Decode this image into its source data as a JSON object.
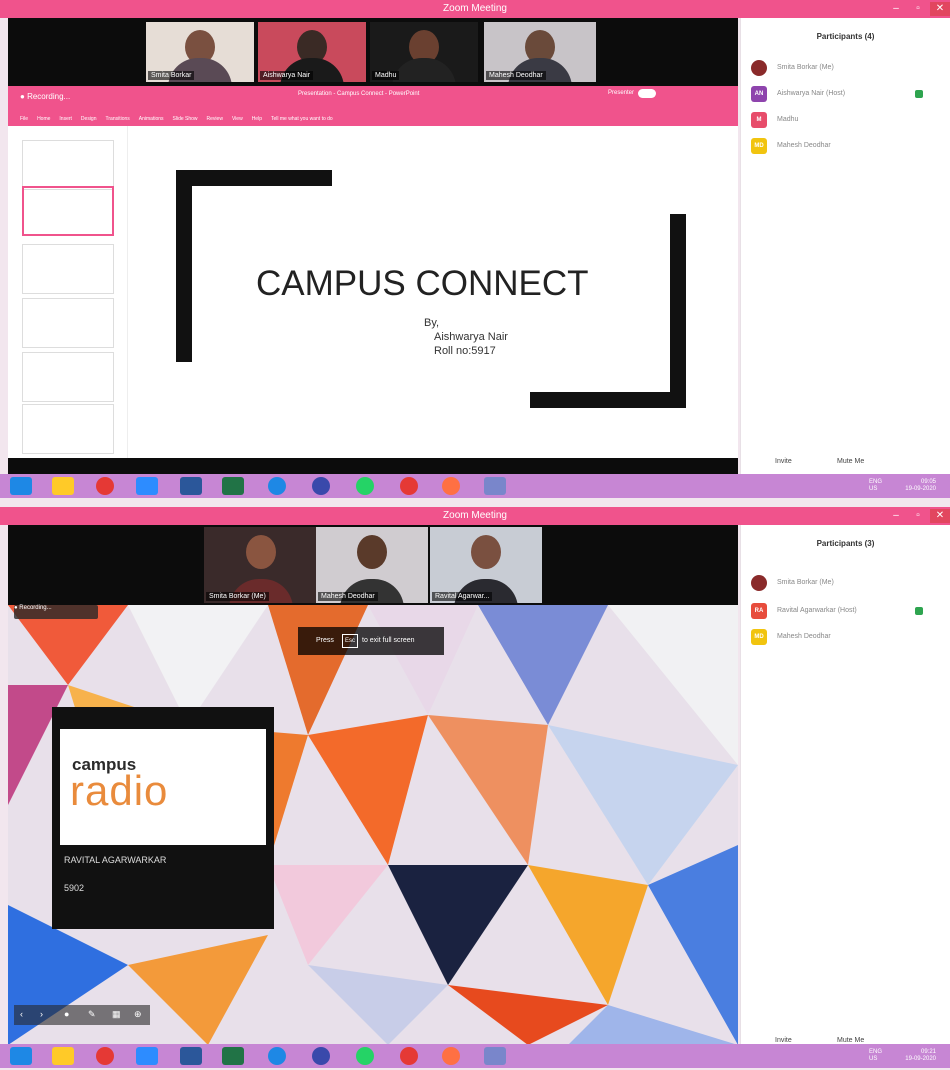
{
  "screen1": {
    "window_title": "Zoom Meeting",
    "participants": [
      {
        "name": "Smita Borkar"
      },
      {
        "name": "Aishwarya Nair"
      },
      {
        "name": "Madhu"
      },
      {
        "name": "Mahesh Deodhar"
      }
    ],
    "recording_label": "Recording...",
    "ppt": {
      "doc_title": "Presentation - Campus Connect - PowerPoint",
      "presenter_label": "Presenter",
      "tabs": [
        "File",
        "Home",
        "Insert",
        "Design",
        "Transitions",
        "Animations",
        "Slide Show",
        "Review",
        "View",
        "Help",
        "Tell me what you want to do"
      ]
    },
    "slide": {
      "title": "CAMPUS CONNECT",
      "by": "By,",
      "author": "Aishwarya Nair",
      "roll": "Roll no:5917"
    },
    "panel": {
      "title": "Participants (4)",
      "list": [
        {
          "name": "Smita Borkar (Me)",
          "initials": "",
          "color": "#c0392b"
        },
        {
          "name": "Aishwarya Nair (Host)",
          "initials": "AN",
          "color": "#8e44ad"
        },
        {
          "name": "Madhu",
          "initials": "M",
          "color": "#e74c6a"
        },
        {
          "name": "Mahesh Deodhar",
          "initials": "MD",
          "color": "#f1c40f"
        }
      ],
      "invite": "Invite",
      "mute": "Mute Me"
    },
    "tray": {
      "lang": "ENG",
      "region": "US",
      "time": "09:05",
      "date": "19-09-2020"
    }
  },
  "screen2": {
    "window_title": "Zoom Meeting",
    "participants": [
      {
        "name": "Smita Borkar (Me)"
      },
      {
        "name": "Mahesh Deodhar"
      },
      {
        "name": "Ravital Agarwar..."
      }
    ],
    "recording_label": "Recording...",
    "esc_overlay": {
      "press": "Press",
      "key": "Esc",
      "rest": "to exit full screen"
    },
    "card": {
      "logo_word1": "campus",
      "logo_word2": "radio",
      "name": "RAVITAL AGARWARKAR",
      "roll": "5902"
    },
    "panel": {
      "title": "Participants (3)",
      "list": [
        {
          "name": "Smita Borkar (Me)",
          "initials": "",
          "color": "#c0392b"
        },
        {
          "name": "Ravital Agarwarkar (Host)",
          "initials": "RA",
          "color": "#e74c3c"
        },
        {
          "name": "Mahesh Deodhar",
          "initials": "MD",
          "color": "#f1c40f"
        }
      ],
      "invite": "Invite",
      "mute": "Mute Me"
    },
    "tray": {
      "lang": "ENG",
      "region": "US",
      "time": "09:21",
      "date": "19-09-2020"
    }
  },
  "taskbar_icons": [
    {
      "icon": "windows-start-icon",
      "color": "#1e88e5"
    },
    {
      "icon": "file-explorer-icon",
      "color": "#ffca28"
    },
    {
      "icon": "chrome-icon",
      "color": "#e53935"
    },
    {
      "icon": "zoom-icon",
      "color": "#2d8cff"
    },
    {
      "icon": "word-icon",
      "color": "#2b579a"
    },
    {
      "icon": "excel-icon",
      "color": "#217346"
    },
    {
      "icon": "ie-icon",
      "color": "#1e88e5"
    },
    {
      "icon": "media-icon",
      "color": "#3949ab"
    },
    {
      "icon": "whatsapp-icon",
      "color": "#25d366"
    },
    {
      "icon": "opera-icon",
      "color": "#e53935"
    },
    {
      "icon": "firefox-icon",
      "color": "#ff7043"
    },
    {
      "icon": "photos-icon",
      "color": "#7986cb"
    }
  ]
}
